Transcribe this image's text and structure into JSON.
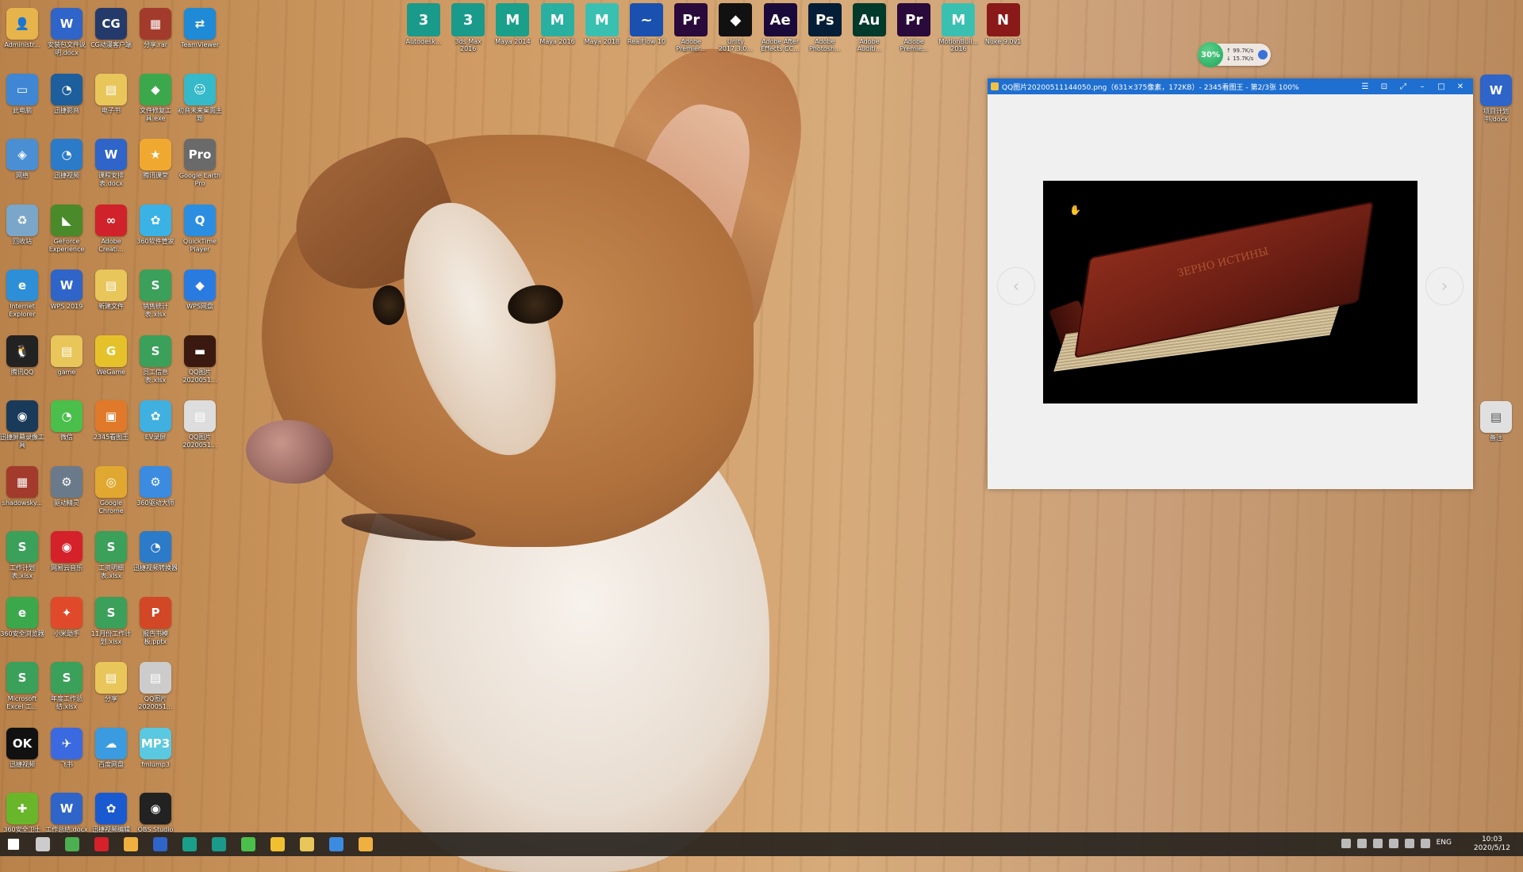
{
  "desktop": {
    "left_icons": [
      {
        "label": "Administr...",
        "color": "#e7b44c",
        "glyph": "👤"
      },
      {
        "label": "安装包文件说明.docx",
        "color": "#2f64c8",
        "glyph": "W"
      },
      {
        "label": "CG动漫客户端",
        "color": "#243a6b",
        "glyph": "CG"
      },
      {
        "label": "分享.rar",
        "color": "#a23b2b",
        "glyph": "▦"
      },
      {
        "label": "TeamViewer",
        "color": "#1f8ad6",
        "glyph": "⇄"
      },
      {
        "label": "此电脑",
        "color": "#3f87d4",
        "glyph": "▭"
      },
      {
        "label": "迅捷影音",
        "color": "#1d5e9c",
        "glyph": "◔"
      },
      {
        "label": "电子书",
        "color": "#e8c65a",
        "glyph": "▤"
      },
      {
        "label": "文件修复工具.exe",
        "color": "#3ca84c",
        "glyph": "◆"
      },
      {
        "label": "初音未来桌面主题",
        "color": "#36b9c9",
        "glyph": "☺"
      },
      {
        "label": "网络",
        "color": "#4a8fd4",
        "glyph": "◈"
      },
      {
        "label": "迅捷视频",
        "color": "#2b7bc8",
        "glyph": "◔"
      },
      {
        "label": "课程安排表.docx",
        "color": "#2f64c8",
        "glyph": "W"
      },
      {
        "label": "腾讯课堂",
        "color": "#f0a930",
        "glyph": "★"
      },
      {
        "label": "Google Earth Pro",
        "color": "#6a6a6a",
        "glyph": "Pro"
      },
      {
        "label": "回收站",
        "color": "#7aa6c9",
        "glyph": "♻"
      },
      {
        "label": "GeForce Experience",
        "color": "#4a8a2a",
        "glyph": "◣"
      },
      {
        "label": "Adobe Creati...",
        "color": "#d0222a",
        "glyph": "∞"
      },
      {
        "label": "360软件管家",
        "color": "#3bb2e6",
        "glyph": "✿"
      },
      {
        "label": "QuickTime Player",
        "color": "#2c8ee0",
        "glyph": "Q"
      },
      {
        "label": "Internet Explorer",
        "color": "#2d8fd8",
        "glyph": "e"
      },
      {
        "label": "WPS 2019",
        "color": "#2f64c8",
        "glyph": "W"
      },
      {
        "label": "新建文件",
        "color": "#e8c65a",
        "glyph": "▤"
      },
      {
        "label": "销售统计表.xlsx",
        "color": "#3aa05a",
        "glyph": "S"
      },
      {
        "label": "WPS网盘",
        "color": "#2a7be0",
        "glyph": "◆"
      },
      {
        "label": "腾讯QQ",
        "color": "#222222",
        "glyph": "🐧"
      },
      {
        "label": "game",
        "color": "#e8c65a",
        "glyph": "▤"
      },
      {
        "label": "WeGame",
        "color": "#e6c22a",
        "glyph": "G"
      },
      {
        "label": "员工信息表.xlsx",
        "color": "#3aa05a",
        "glyph": "S"
      },
      {
        "label": "QQ图片2020051...",
        "color": "#3a1a10",
        "glyph": "▬"
      },
      {
        "label": "迅捷屏幕录像工具",
        "color": "#1a3a5a",
        "glyph": "◉"
      },
      {
        "label": "微信",
        "color": "#4bbf4b",
        "glyph": "◔"
      },
      {
        "label": "2345看图王",
        "color": "#e07a2a",
        "glyph": "▣"
      },
      {
        "label": "EV录屏",
        "color": "#40b0e0",
        "glyph": "✿"
      },
      {
        "label": "QQ图片2020051...",
        "color": "#ddd",
        "glyph": "▤"
      },
      {
        "label": "shadowsky...",
        "color": "#a23b2b",
        "glyph": "▦"
      },
      {
        "label": "驱动精灵",
        "color": "#6a7a8a",
        "glyph": "⚙"
      },
      {
        "label": "Google Chrome",
        "color": "#e0a830",
        "glyph": "◎"
      },
      {
        "label": "360驱动大师",
        "color": "#3b8be0",
        "glyph": "⚙"
      },
      {
        "label": "",
        "color": "rgba(0,0,0,0)",
        "glyph": ""
      },
      {
        "label": "工作计划表.xlsx",
        "color": "#3aa05a",
        "glyph": "S"
      },
      {
        "label": "网易云音乐",
        "color": "#d4212a",
        "glyph": "◉"
      },
      {
        "label": "工资明细表.xlsx",
        "color": "#3aa05a",
        "glyph": "S"
      },
      {
        "label": "迅捷视频转换器",
        "color": "#2b7bc8",
        "glyph": "◔"
      },
      {
        "label": "",
        "color": "rgba(0,0,0,0)",
        "glyph": ""
      },
      {
        "label": "360安全浏览器",
        "color": "#3ca84c",
        "glyph": "e"
      },
      {
        "label": "小米助手",
        "color": "#e04a2a",
        "glyph": "✦"
      },
      {
        "label": "11月份工作计划.xlsx",
        "color": "#3aa05a",
        "glyph": "S"
      },
      {
        "label": "报告书模板.pptx",
        "color": "#d24726",
        "glyph": "P"
      },
      {
        "label": "",
        "color": "rgba(0,0,0,0)",
        "glyph": ""
      },
      {
        "label": "Microsoft Excel 工...",
        "color": "#3aa05a",
        "glyph": "S"
      },
      {
        "label": "年度工作总结.xlsx",
        "color": "#3aa05a",
        "glyph": "S"
      },
      {
        "label": "分享",
        "color": "#e8c65a",
        "glyph": "▤"
      },
      {
        "label": "QQ图片2020051...",
        "color": "#ccc",
        "glyph": "▤"
      },
      {
        "label": "",
        "color": "rgba(0,0,0,0)",
        "glyph": ""
      },
      {
        "label": "迅捷视频",
        "color": "#111",
        "glyph": "OK"
      },
      {
        "label": "飞书",
        "color": "#3b6ae0",
        "glyph": "✈"
      },
      {
        "label": "百度网盘",
        "color": "#3b9be0",
        "glyph": "☁"
      },
      {
        "label": "fmlump3",
        "color": "#5ac8e0",
        "glyph": "MP3"
      },
      {
        "label": "",
        "color": "rgba(0,0,0,0)",
        "glyph": ""
      },
      {
        "label": "360安全卫士",
        "color": "#6ab62a",
        "glyph": "✚"
      },
      {
        "label": "工作总结.docx",
        "color": "#2f64c8",
        "glyph": "W"
      },
      {
        "label": "迅捷视频编辑",
        "color": "#1a5ad0",
        "glyph": "✿"
      },
      {
        "label": "OBS Studio",
        "color": "#222",
        "glyph": "◉"
      },
      {
        "label": "",
        "color": "rgba(0,0,0,0)",
        "glyph": ""
      }
    ],
    "top_icons": [
      {
        "label": "Autodesk...",
        "color": "#1a9a8a",
        "glyph": "3"
      },
      {
        "label": "3ds Max 2016",
        "color": "#1a9a8a",
        "glyph": "3"
      },
      {
        "label": "Maya 2014",
        "color": "#1aa08a",
        "glyph": "M"
      },
      {
        "label": "Maya 2016",
        "color": "#2ab0a0",
        "glyph": "M"
      },
      {
        "label": "Maya 2018",
        "color": "#3ac0b0",
        "glyph": "M"
      },
      {
        "label": "RealFlow 10",
        "color": "#1a50b0",
        "glyph": "~"
      },
      {
        "label": "Adobe Premier...",
        "color": "#2a0a3a",
        "glyph": "Pr"
      },
      {
        "label": "Unity 2017.3.0...",
        "color": "#111111",
        "glyph": "◆"
      },
      {
        "label": "Adobe After Effects CC...",
        "color": "#1a0a3a",
        "glyph": "Ae"
      },
      {
        "label": "Adobe Photosh...",
        "color": "#031e36",
        "glyph": "Ps"
      },
      {
        "label": "Adobe Auditi...",
        "color": "#003a2a",
        "glyph": "Au"
      },
      {
        "label": "Adobe Premie...",
        "color": "#2a0a3a",
        "glyph": "Pr"
      },
      {
        "label": "MotionBuil... 2016",
        "color": "#3ac0b0",
        "glyph": "M"
      },
      {
        "label": "Nuke 9.0v1",
        "color": "#8a1a1a",
        "glyph": "N"
      }
    ],
    "right_icons": [
      {
        "label": "项目计划书.docx",
        "color": "#2f64c8",
        "glyph": "W"
      },
      {
        "label": "备注",
        "color": "#e0e0e0",
        "glyph": "▤"
      }
    ]
  },
  "speed_widget": {
    "percent": "30%",
    "upload": "↑ 99.7K/s",
    "download": "↓ 15.7K/s"
  },
  "viewer": {
    "title": "QQ图片20200511144050.png（631×375像素，172KB）- 2345看图王 - 第2/3张 100%",
    "controls": [
      "☰",
      "⊡",
      "⤢",
      "–",
      "□",
      "✕"
    ],
    "book_text": "ЗЕРНО ИСТИНЫ"
  },
  "taskbar": {
    "items": [
      {
        "name": "start",
        "color": "#ffffff"
      },
      {
        "name": "task-view",
        "color": "#cccccc"
      },
      {
        "name": "360browser",
        "color": "#4caf50"
      },
      {
        "name": "netease",
        "color": "#d4212a"
      },
      {
        "name": "files-app",
        "color": "#f0b040"
      },
      {
        "name": "wps",
        "color": "#2f64c8"
      },
      {
        "name": "maya",
        "color": "#1aa08a"
      },
      {
        "name": "3dsmax",
        "color": "#1a9a8a"
      },
      {
        "name": "wechat",
        "color": "#4bbf4b"
      },
      {
        "name": "browser-yellow",
        "color": "#f0c030"
      },
      {
        "name": "explorer",
        "color": "#e8c65a"
      },
      {
        "name": "ps-tool",
        "color": "#3b8be0"
      },
      {
        "name": "viewer-app",
        "color": "#f0b040"
      }
    ],
    "lang": "ENG",
    "time": "10:03",
    "date": "2020/5/12"
  }
}
